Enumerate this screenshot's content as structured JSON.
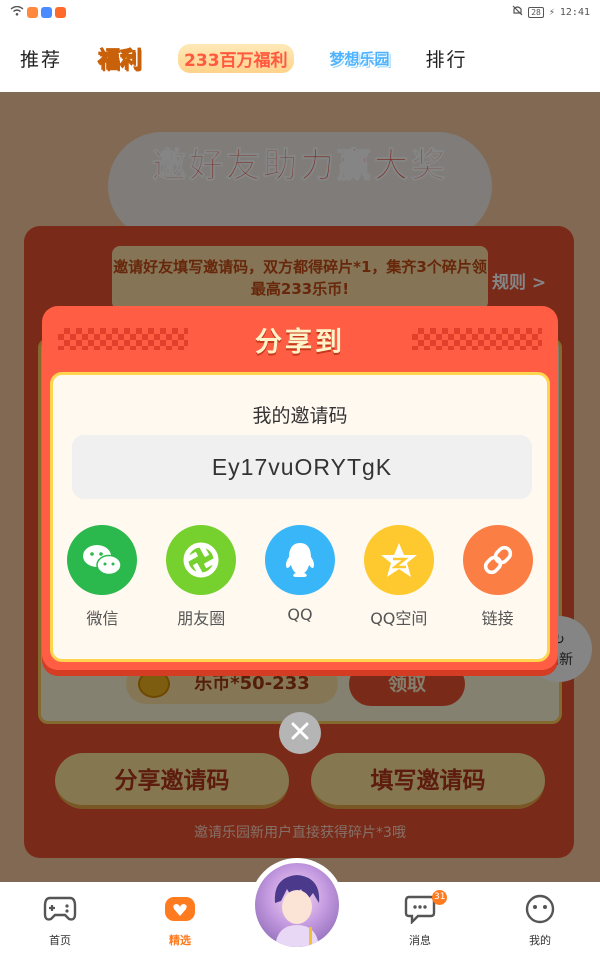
{
  "status_bar": {
    "battery": "28",
    "time": "12:41"
  },
  "top_nav": {
    "tabs": [
      {
        "label": "推荐"
      },
      {
        "label": "福利"
      },
      {
        "label": "233百万福利"
      },
      {
        "label": "梦想乐园"
      },
      {
        "label": "排行"
      }
    ]
  },
  "background_page": {
    "title": "邀好友助力赢大奖",
    "ribbon_text": "邀请好友填写邀请码，双方都得碎片*1，集齐3个碎片领最高233乐币!",
    "rules_label": "规则 >",
    "reward_text": "乐币*50-233",
    "claim_label": "领取",
    "share_code_button": "分享邀请码",
    "fill_code_button": "填写邀请码",
    "footer_note": "邀请乐园新用户直接获得碎片*3哦",
    "refresh_label": "刷新"
  },
  "share_dialog": {
    "title": "分享到",
    "code_label": "我的邀请码",
    "invite_code": "Ey17vuORYTgK",
    "options": [
      {
        "label": "微信",
        "icon": "wechat-icon",
        "color": "#2bb84c"
      },
      {
        "label": "朋友圈",
        "icon": "moments-icon",
        "color": "#76d12f"
      },
      {
        "label": "QQ",
        "icon": "qq-icon",
        "color": "#39b6f7"
      },
      {
        "label": "QQ空间",
        "icon": "qzone-icon",
        "color": "#fdc92e"
      },
      {
        "label": "链接",
        "icon": "link-icon",
        "color": "#fb7f45"
      }
    ]
  },
  "tab_bar": {
    "tabs": [
      {
        "label": "首页",
        "icon": "gamepad-icon"
      },
      {
        "label": "精选",
        "icon": "heart-icon",
        "active": true
      },
      {
        "label": "",
        "icon": "avatar"
      },
      {
        "label": "消息",
        "icon": "chat-icon",
        "badge": "31"
      },
      {
        "label": "我的",
        "icon": "face-icon"
      }
    ]
  },
  "colors": {
    "accent": "#ff5e44",
    "active_tab": "#ff7b1f",
    "dialog_border": "#ffd54f"
  }
}
